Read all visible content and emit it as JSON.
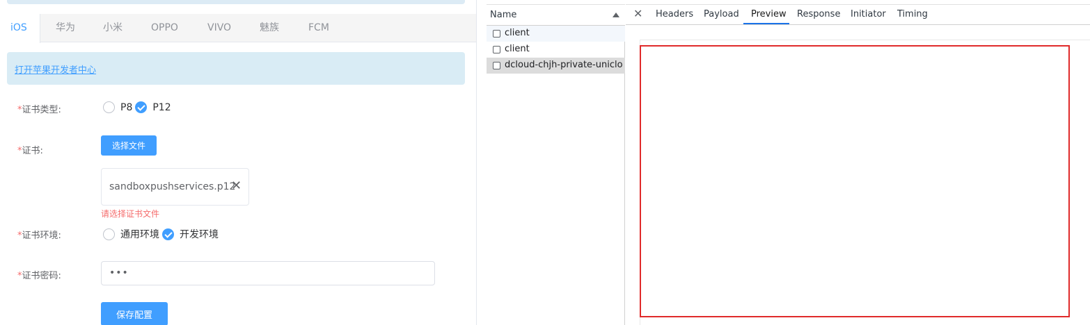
{
  "left": {
    "tabs": [
      "iOS",
      "华为",
      "小米",
      "OPPO",
      "VIVO",
      "魅族",
      "FCM"
    ],
    "info_link": "打开苹果开发者中心",
    "cert_type": {
      "label": "证书类型:",
      "options": [
        "P8",
        "P12"
      ],
      "selected": "P12"
    },
    "cert": {
      "label": "证书:",
      "button": "选择文件",
      "file_name": "sandboxpushservices.p12",
      "error": "请选择证书文件"
    },
    "cert_env": {
      "label": "证书环境:",
      "options": [
        "通用环境",
        "开发环境"
      ],
      "selected": "开发环境"
    },
    "cert_password": {
      "label": "证书密码:",
      "value": "•••"
    },
    "save_button": "保存配置",
    "required_mark": "*"
  },
  "network": {
    "column_header": "Name",
    "requests": [
      "client",
      "client",
      "dcloud-chjh-private-uniclo..."
    ],
    "selected_index": 2
  },
  "details": {
    "tabs": [
      "Headers",
      "Payload",
      "Preview",
      "Response",
      "Initiator",
      "Timing"
    ],
    "active_tab": "Preview"
  },
  "colors": {
    "accent": "#409eff",
    "error": "#f56c6c",
    "highlight_frame": "#e02a2a"
  }
}
